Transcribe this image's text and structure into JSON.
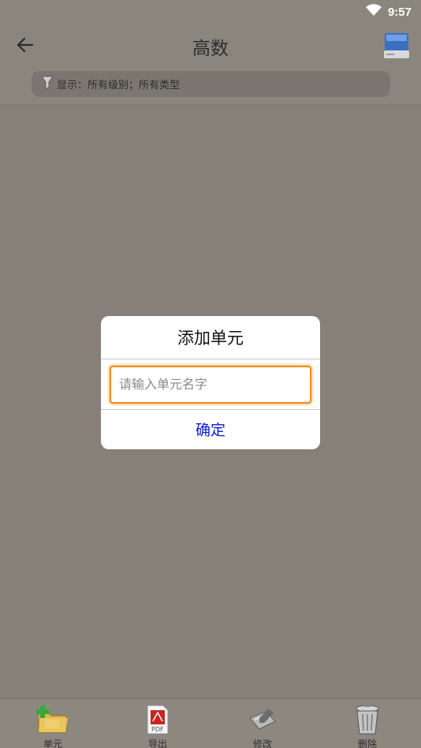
{
  "status": {
    "time": "9:57"
  },
  "header": {
    "title": "高数"
  },
  "filter": {
    "text": "显示：所有级别；所有类型"
  },
  "dialog": {
    "title": "添加单元",
    "input": {
      "placeholder": "请输入单元名字",
      "value": ""
    },
    "confirm_label": "确定"
  },
  "bottom_nav": {
    "items": [
      {
        "label": "单元",
        "icon": "folder-add-icon"
      },
      {
        "label": "导出",
        "icon": "pdf-icon"
      },
      {
        "label": "修改",
        "icon": "edit-icon"
      },
      {
        "label": "删除",
        "icon": "trash-icon"
      }
    ]
  },
  "colors": {
    "accent_border": "#f08d1f",
    "confirm_text": "#0a1ad6",
    "scrim": "#868079"
  }
}
